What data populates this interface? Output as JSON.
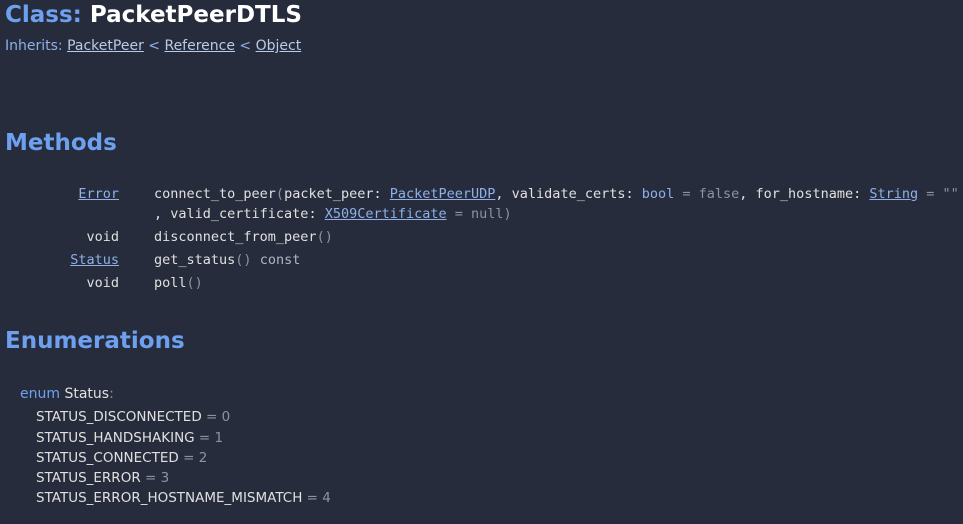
{
  "header": {
    "class_keyword": "Class:",
    "class_name": "PacketPeerDTLS",
    "inherits_label": "Inherits:",
    "inherits_chain": [
      "PacketPeer",
      "Reference",
      "Object"
    ],
    "separator": "<"
  },
  "sections": {
    "methods_title": "Methods",
    "enumerations_title": "Enumerations"
  },
  "methods": [
    {
      "return_type": "Error",
      "name": "connect_to_peer",
      "params_line1": {
        "p1_name": "packet_peer",
        "p1_type": "PacketPeerUDP",
        "p2_name": "validate_certs",
        "p2_type": "bool",
        "p2_default": "false",
        "p3_name": "for_hostname",
        "p3_type": "String",
        "p3_default": "\"\""
      },
      "params_line2": {
        "p4_name": "valid_certificate",
        "p4_type": "X509Certificate",
        "p4_default": "null"
      }
    },
    {
      "return_type": "void",
      "name": "disconnect_from_peer"
    },
    {
      "return_type": "Status",
      "name": "get_status",
      "qualifier": "const"
    },
    {
      "return_type": "void",
      "name": "poll"
    }
  ],
  "enum": {
    "keyword": "enum",
    "name": "Status",
    "colon": ":",
    "constants": [
      {
        "name": "STATUS_DISCONNECTED",
        "value": "0"
      },
      {
        "name": "STATUS_HANDSHAKING",
        "value": "1"
      },
      {
        "name": "STATUS_CONNECTED",
        "value": "2"
      },
      {
        "name": "STATUS_ERROR",
        "value": "3"
      },
      {
        "name": "STATUS_ERROR_HOSTNAME_MISMATCH",
        "value": "4"
      }
    ]
  },
  "colors": {
    "background": "#262c3b",
    "heading": "#6ea0f0",
    "link": "#8fb0e8",
    "muted": "#8c93a3"
  }
}
